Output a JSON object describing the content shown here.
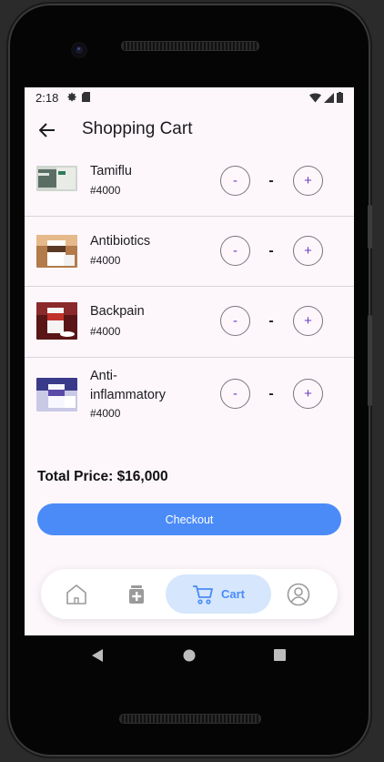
{
  "status": {
    "time": "2:18"
  },
  "appbar": {
    "title": "Shopping Cart",
    "back_icon": "arrow-back-icon"
  },
  "cart": {
    "items": [
      {
        "name": "Tamiflu",
        "price": "#4000",
        "quantity": "-",
        "minus_label": "-",
        "plus_label": "+"
      },
      {
        "name": "Antibiotics",
        "price": "#4000",
        "quantity": "-",
        "minus_label": "-",
        "plus_label": "+"
      },
      {
        "name": "Backpain",
        "price": "#4000",
        "quantity": "-",
        "minus_label": "-",
        "plus_label": "+"
      },
      {
        "name": "Anti-\ninflammatory",
        "price": "#4000",
        "quantity": "-",
        "minus_label": "-",
        "plus_label": "+"
      }
    ],
    "total_label": "Total Price: $16,000",
    "checkout_label": "Checkout"
  },
  "bottom_nav": {
    "items": [
      {
        "icon": "home-icon",
        "label": ""
      },
      {
        "icon": "medicine-icon",
        "label": ""
      },
      {
        "icon": "cart-icon",
        "label": "Cart",
        "active": true
      },
      {
        "icon": "profile-icon",
        "label": ""
      }
    ]
  },
  "colors": {
    "accent": "#4a8bf8",
    "active_tab_bg": "#d5e6fd",
    "stepper_text": "#6a3ec0",
    "screen_bg": "#fdf7fc"
  }
}
